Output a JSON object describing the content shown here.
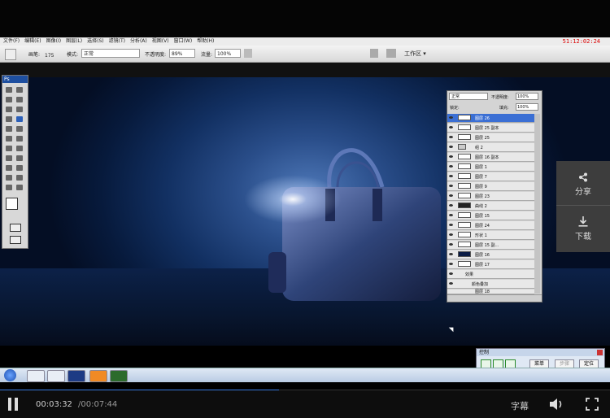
{
  "clock": "51:12:02:24",
  "menu": [
    "文件(F)",
    "编辑(E)",
    "图像(I)",
    "图层(L)",
    "选择(S)",
    "滤镜(T)",
    "分析(A)",
    "视图(V)",
    "窗口(W)",
    "帮助(H)"
  ],
  "options": {
    "brush_label": "画笔:",
    "brush_size": "175",
    "mode_label": "模式:",
    "mode_value": "正常",
    "opacity_label": "不透明度:",
    "opacity_value": "89%",
    "flow_label": "流量:",
    "flow_value": "100%",
    "workspace": "工作区 ▾"
  },
  "toolbox": {
    "title": "Ps"
  },
  "layers": {
    "blend_mode": "正常",
    "opacity_label": "不透明度:",
    "opacity_value": "100%",
    "lock_label": "锁定:",
    "fill_label": "填充:",
    "fill_value": "100%",
    "rows": [
      "图层 26",
      "图层 25 副本",
      "图层 25",
      "组 2",
      "图层 16 副本",
      "图层 1",
      "图层 7",
      "图层 9",
      "图层 23",
      "曲线 2",
      "图层 15",
      "图层 24",
      "形状 1",
      "图层 15 副...",
      "图层 16",
      "图层 17",
      "效果",
      "颜色叠加",
      "图层 18"
    ]
  },
  "side": {
    "share": "分享",
    "download": "下载"
  },
  "control_window": {
    "title": "控制",
    "btn1": "菜单",
    "btn2": "步骤",
    "btn3": "定位"
  },
  "player": {
    "current": "00:03:32",
    "total": "/00:07:44",
    "subtitle": "字幕",
    "progress_fraction": 0.457
  }
}
